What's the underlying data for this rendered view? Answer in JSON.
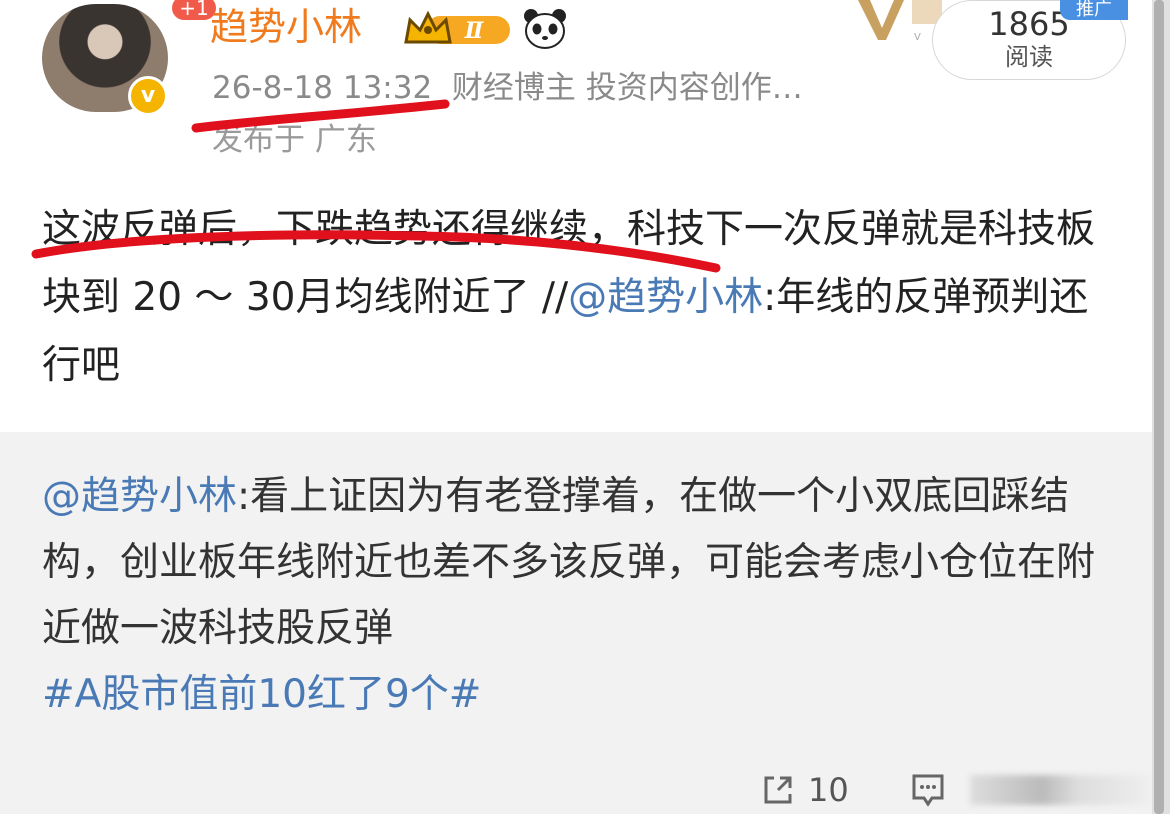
{
  "post": {
    "username": "趋势小林",
    "badge_level": "Ⅱ",
    "plus_one": "+1",
    "verified_mark": "v",
    "timestamp": "26-8-18 13:32",
    "profile_desc": "财经博主 投资内容创作…",
    "location": "发布于 广东",
    "read_count": "1865",
    "read_label": "阅读",
    "promo_label": "推广",
    "body_main": "这波反弹后，下跌趋势还得继续，科技下一次反弹就是科技板块到 20 ～ 30月均线附近了 //",
    "body_mention": "@趋势小林",
    "body_tail": ":年线的反弹预判还行吧"
  },
  "repost": {
    "mention": "@趋势小林",
    "text": ":看上证因为有老登撑着，在做一个小双底回踩结构，创业板年线附近也差不多该反弹，可能会考虑小仓位在附近做一波科技股反弹",
    "hashtag": "#A股市值前10红了9个#"
  },
  "actions": {
    "repost_count": "10",
    "icons": [
      "share-icon",
      "comment-icon"
    ]
  },
  "colors": {
    "username": "#f07b1e",
    "link": "#4a7ab5",
    "annotation": "#e0101c",
    "repost_bg": "#f2f2f2"
  }
}
